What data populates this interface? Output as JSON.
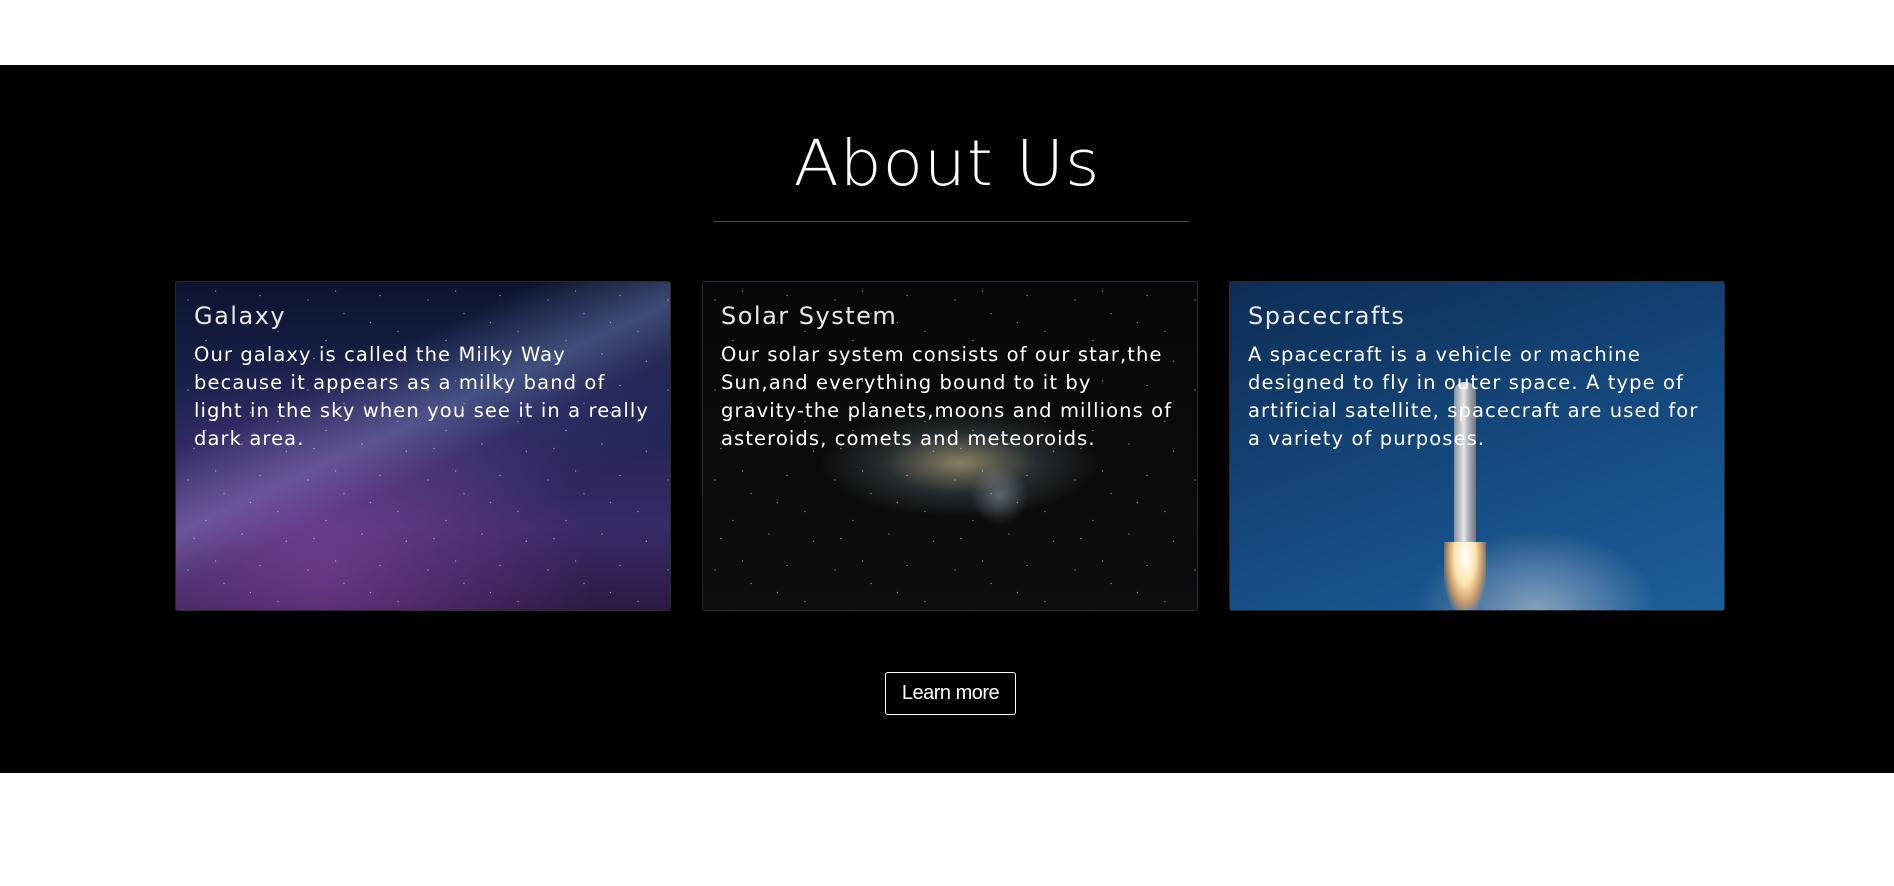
{
  "about": {
    "title": "About Us",
    "cards": [
      {
        "heading": "Galaxy",
        "text": "Our galaxy is called the Milky Way because it appears as a milky band of light in the sky when you see it in a really dark area."
      },
      {
        "heading": "Solar System",
        "text": "Our solar system consists of our star,the Sun,and everything bound to it by gravity-the planets,moons and millions of asteroids, comets and meteoroids."
      },
      {
        "heading": "Spacecrafts",
        "text": "A spacecraft is a vehicle or machine designed to fly in outer space. A type of artificial satellite, spacecraft are used for a variety of purposes."
      }
    ],
    "learn_more_label": "Learn more"
  },
  "colors": {
    "section_background": "#000000",
    "page_background": "#ffffff",
    "text": "#ffffff"
  }
}
